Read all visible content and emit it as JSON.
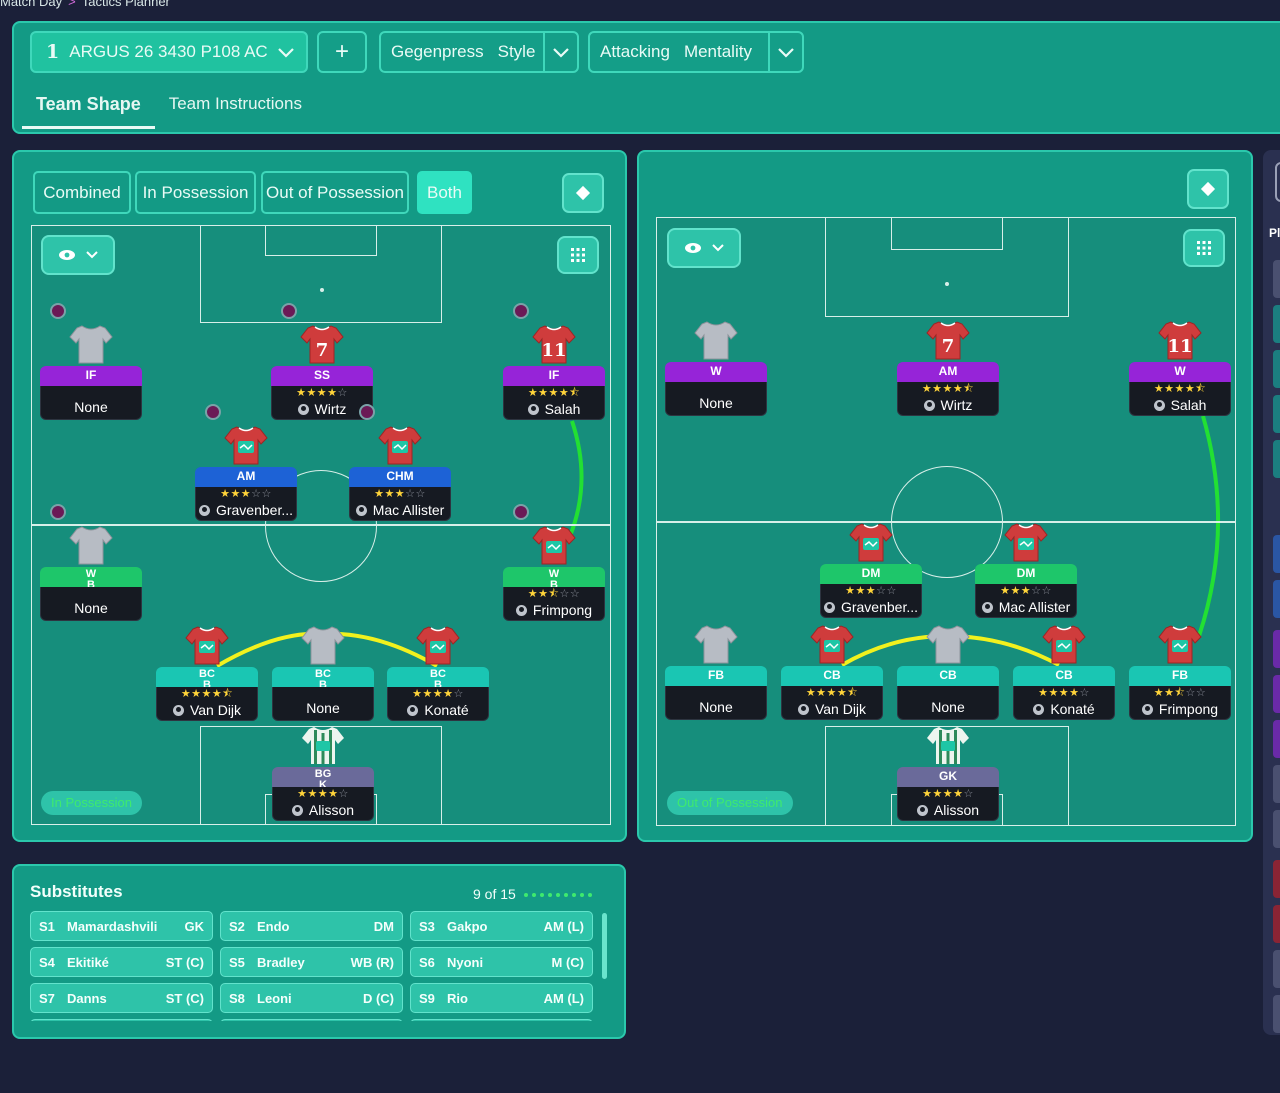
{
  "breadcrumb": {
    "parent": "Match Day",
    "current": "Tactics Planner"
  },
  "topbar": {
    "tactic_number": "1",
    "tactic_name": "ARGUS 26 3430 P108 AC",
    "add_label": "+",
    "style_value": "Gegenpress",
    "style_label": "Style",
    "mentality_value": "Attacking",
    "mentality_label": "Mentality",
    "tabs": [
      {
        "label": "Team Shape",
        "active": true
      },
      {
        "label": "Team Instructions",
        "active": false
      }
    ]
  },
  "view_modes": [
    {
      "label": "Combined",
      "active": false
    },
    {
      "label": "In Possession",
      "active": false
    },
    {
      "label": "Out of Possession",
      "active": false
    },
    {
      "label": "Both",
      "active": true
    }
  ],
  "pitch_left": {
    "phase_label": "In Possession",
    "players": [
      {
        "role": "IF",
        "name": "None",
        "stars": 0,
        "kit": "gray"
      },
      {
        "role": "SS",
        "name": "Wirtz",
        "stars": 4,
        "kit": "red",
        "number": "7"
      },
      {
        "role": "IF",
        "name": "Salah",
        "stars": 4.5,
        "kit": "red",
        "number": "11"
      },
      {
        "role": "AM",
        "name": "Gravenber...",
        "stars": 3,
        "kit": "red"
      },
      {
        "role": "CHM",
        "name": "Mac Allister",
        "stars": 3,
        "kit": "red"
      },
      {
        "role": "W B",
        "name": "None",
        "stars": 0,
        "kit": "gray"
      },
      {
        "role": "W B",
        "name": "Frimpong",
        "stars": 2.5,
        "kit": "red"
      },
      {
        "role": "BC B",
        "name": "Van Dijk",
        "stars": 4.5,
        "kit": "red"
      },
      {
        "role": "BC B",
        "name": "None",
        "stars": 0,
        "kit": "gray"
      },
      {
        "role": "BC B",
        "name": "Konaté",
        "stars": 4,
        "kit": "red"
      },
      {
        "role": "BG K",
        "name": "Alisson",
        "stars": 4,
        "kit": "gk"
      }
    ]
  },
  "pitch_right": {
    "phase_label": "Out of Possession",
    "players": [
      {
        "role": "W",
        "name": "None",
        "stars": 0,
        "kit": "gray"
      },
      {
        "role": "AM",
        "name": "Wirtz",
        "stars": 4.5,
        "kit": "red",
        "number": "7"
      },
      {
        "role": "W",
        "name": "Salah",
        "stars": 4.5,
        "kit": "red",
        "number": "11"
      },
      {
        "role": "DM",
        "name": "Gravenber...",
        "stars": 3,
        "kit": "red"
      },
      {
        "role": "DM",
        "name": "Mac Allister",
        "stars": 3,
        "kit": "red"
      },
      {
        "role": "FB",
        "name": "None",
        "stars": 0,
        "kit": "gray"
      },
      {
        "role": "CB",
        "name": "Van Dijk",
        "stars": 4.5,
        "kit": "red"
      },
      {
        "role": "CB",
        "name": "None",
        "stars": 0,
        "kit": "gray"
      },
      {
        "role": "CB",
        "name": "Konaté",
        "stars": 4,
        "kit": "red"
      },
      {
        "role": "FB",
        "name": "Frimpong",
        "stars": 2.5,
        "kit": "red"
      },
      {
        "role": "GK",
        "name": "Alisson",
        "stars": 4,
        "kit": "gk"
      }
    ]
  },
  "substitutes": {
    "title": "Substitutes",
    "count": "9 of 15",
    "filled": 9,
    "total": 15,
    "items": [
      {
        "slot": "S1",
        "name": "Mamardashvili",
        "position": "GK"
      },
      {
        "slot": "S2",
        "name": "Endo",
        "position": "DM"
      },
      {
        "slot": "S3",
        "name": "Gakpo",
        "position": "AM (L)"
      },
      {
        "slot": "S4",
        "name": "Ekitiké",
        "position": "ST (C)"
      },
      {
        "slot": "S5",
        "name": "Bradley",
        "position": "WB (R)"
      },
      {
        "slot": "S6",
        "name": "Nyoni",
        "position": "M (C)"
      },
      {
        "slot": "S7",
        "name": "Danns",
        "position": "ST (C)"
      },
      {
        "slot": "S8",
        "name": "Leoni",
        "position": "D (C)"
      },
      {
        "slot": "S9",
        "name": "Rio",
        "position": "AM (L)"
      }
    ]
  },
  "edge": {
    "label": "Pl"
  },
  "colors": {
    "panel": "#139a85",
    "accent": "#2fe2c1",
    "role_purple": "#9624d8",
    "role_blue": "#1d62d6",
    "role_green": "#1ec66a",
    "role_teal": "#1ac6b3",
    "link_green": "#22e033",
    "link_yellow": "#f1f11e",
    "background": "#1b2039"
  }
}
